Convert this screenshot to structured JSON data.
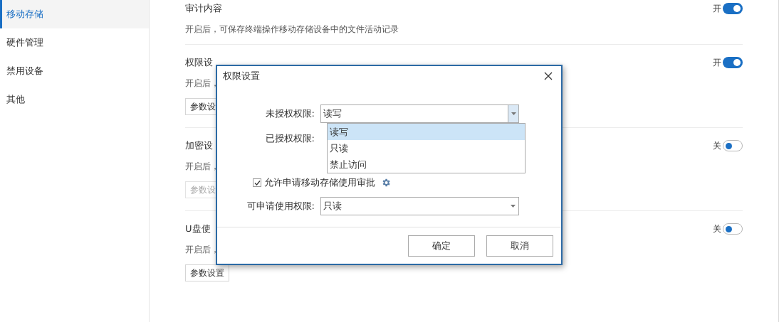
{
  "sidebar": {
    "items": [
      {
        "label": "移动存储",
        "selected": true
      },
      {
        "label": "硬件管理",
        "selected": false
      },
      {
        "label": "禁用设备",
        "selected": false
      },
      {
        "label": "其他",
        "selected": false
      }
    ]
  },
  "sections": [
    {
      "title": "审计内容",
      "description": "开启后，可保存终端操作移动存储设备中的文件活动记录",
      "toggle_label": "开",
      "on": true
    },
    {
      "title": "权限设",
      "description": "开启后，",
      "toggle_label": "开",
      "on": true,
      "button": {
        "label": "参数设",
        "disabled": false
      }
    },
    {
      "title": "加密设",
      "description": "开启后，",
      "toggle_label": "关",
      "on": false,
      "button": {
        "label": "参数设",
        "disabled": true
      }
    },
    {
      "title": "U盘使",
      "description": "开启后，",
      "toggle_label": "关",
      "on": false,
      "button": {
        "label": "参数设置",
        "disabled": false
      }
    }
  ],
  "dialog": {
    "title": "权限设置",
    "unauthorized": {
      "label": "未授权权限:",
      "value": "读写",
      "expanded": true,
      "options": [
        {
          "label": "读写",
          "selected": true
        },
        {
          "label": "只读",
          "selected": false
        },
        {
          "label": "禁止访问",
          "selected": false
        }
      ]
    },
    "authorized": {
      "label": "已授权权限:"
    },
    "approval": {
      "label": "允许申请移动存储使用审批",
      "checked": true
    },
    "apply": {
      "label": "可申请使用权限:",
      "value": "只读"
    },
    "buttons": [
      "确定",
      "取消"
    ]
  }
}
